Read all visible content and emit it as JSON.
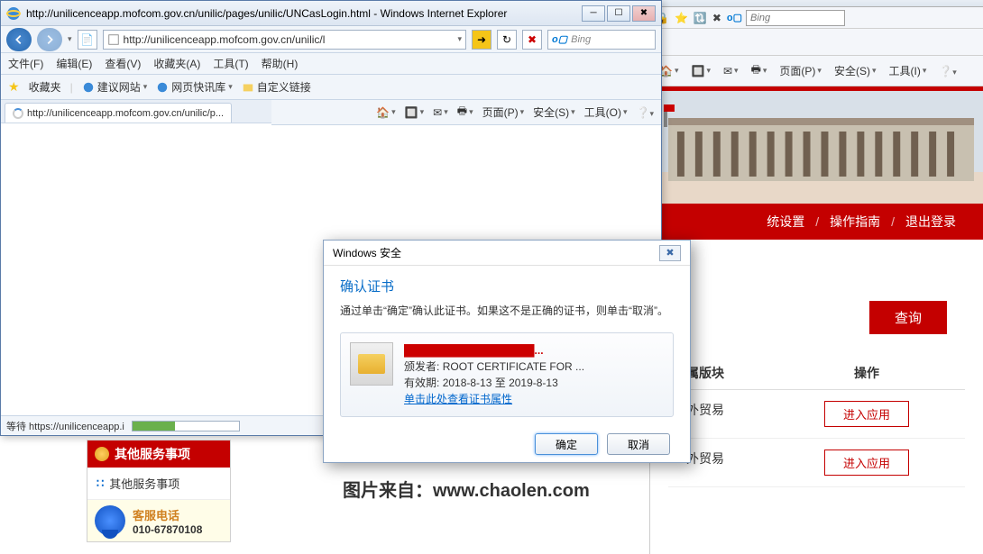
{
  "back_window": {
    "toolbar_icons": [
      "🔒",
      "⭐",
      "🔃",
      "✖"
    ],
    "search_placeholder": "Bing",
    "cmdbar": {
      "page": "页面(P)",
      "safety": "安全(S)",
      "tools": "工具(I)"
    },
    "nav": {
      "settings": "统设置",
      "guide": "操作指南",
      "logout": "退出登录"
    },
    "query_btn": "查询",
    "table": {
      "headers": {
        "module": "属版块",
        "action": "操作"
      },
      "rows": [
        {
          "module": "外贸易",
          "action": "进入应用"
        },
        {
          "module": "外贸易",
          "action": "进入应用"
        }
      ]
    }
  },
  "ie_window": {
    "title": "http://unilicenceapp.mofcom.gov.cn/unilic/pages/unilic/UNCasLogin.html - Windows Internet Explorer",
    "address": "http://unilicenceapp.mofcom.gov.cn/unilic/l",
    "search_placeholder": "Bing",
    "menus": {
      "file": "文件(F)",
      "edit": "编辑(E)",
      "view": "查看(V)",
      "favorites": "收藏夹(A)",
      "tools": "工具(T)",
      "help": "帮助(H)"
    },
    "favbar": {
      "favorites": "收藏夹",
      "suggested": "建议网站",
      "slices": "网页快讯库",
      "custom": "自定义链接"
    },
    "tab_text": "http://unilicenceapp.mofcom.gov.cn/unilic/p...",
    "cmdbar": {
      "page": "页面(P)",
      "safety": "安全(S)",
      "tools": "工具(O)"
    },
    "status": "等待 https://unilicenceapp.i"
  },
  "dialog": {
    "title": "Windows 安全",
    "heading": "确认证书",
    "description": "通过单击“确定”确认此证书。如果这不是正确的证书，则单击“取消”。",
    "cert": {
      "name_placeholder": "█████████████████...",
      "issuer_label": "颁发者:",
      "issuer": "ROOT CERTIFICATE FOR ...",
      "validity_label": "有效期:",
      "validity": "2018-8-13 至 2019-8-13",
      "view_link": "单击此处查看证书属性"
    },
    "ok": "确定",
    "cancel": "取消"
  },
  "sidebar": {
    "title": "其他服务事项",
    "item1": "其他服务事项",
    "phone_label": "客服电话",
    "phone_number": "010-67870108"
  },
  "watermark": "图片来自：www.chaolen.com"
}
